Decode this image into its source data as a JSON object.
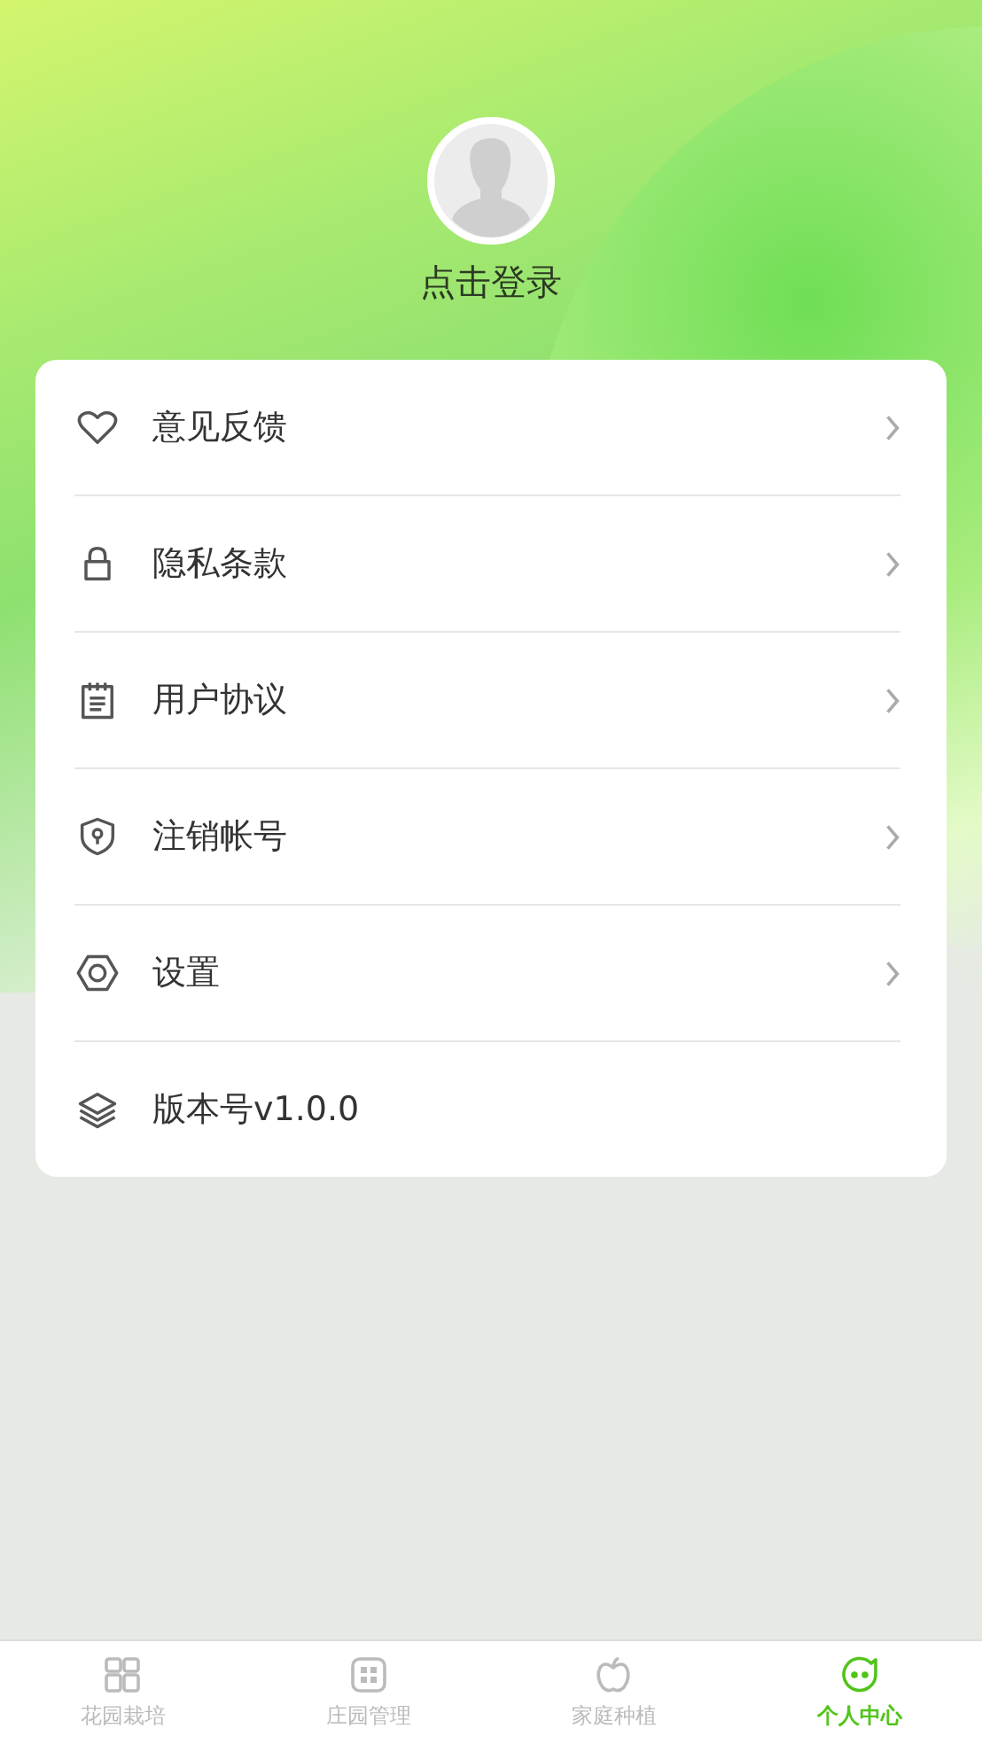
{
  "profile": {
    "login_label": "点击登录"
  },
  "menu": [
    {
      "label": "意见反馈",
      "kind": "link"
    },
    {
      "label": "隐私条款",
      "kind": "link"
    },
    {
      "label": "用户协议",
      "kind": "link"
    },
    {
      "label": "注销帐号",
      "kind": "link"
    },
    {
      "label": "设置",
      "kind": "link"
    },
    {
      "label": "版本号v1.0.0",
      "kind": "info"
    }
  ],
  "tab_bar": [
    {
      "label": "花园栽培",
      "selected": false
    },
    {
      "label": "庄园管理",
      "selected": false
    },
    {
      "label": "家庭种植",
      "selected": false
    },
    {
      "label": "个人中心",
      "selected": true
    }
  ]
}
